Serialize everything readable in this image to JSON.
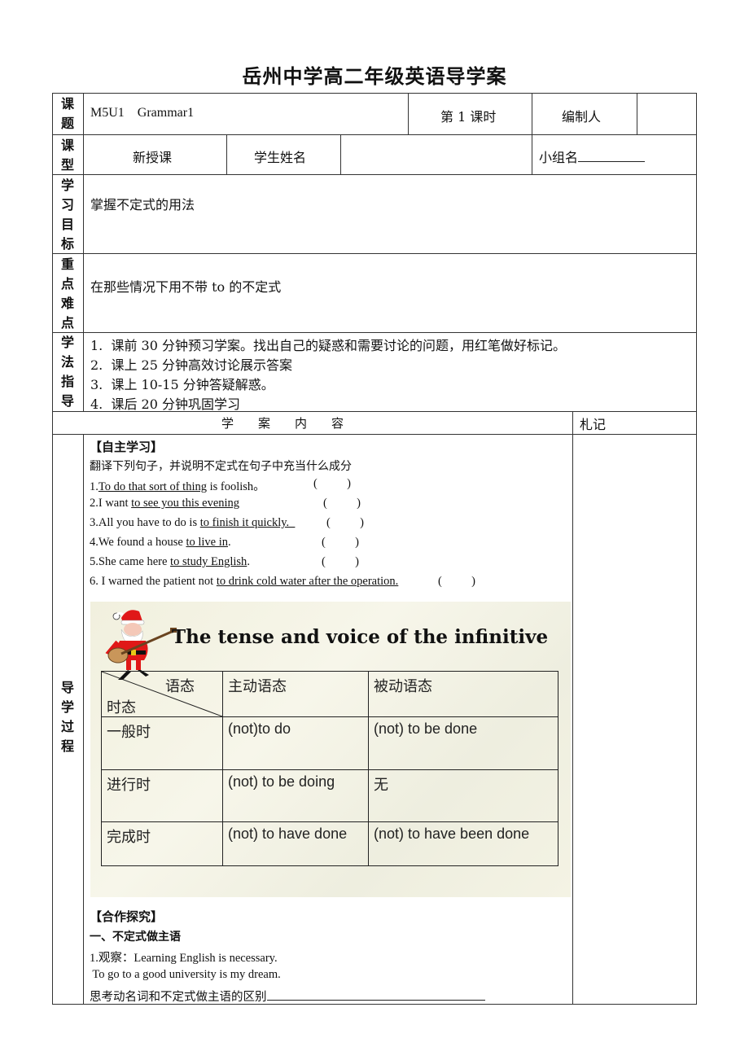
{
  "document": {
    "title": "岳州中学高二年级英语导学案"
  },
  "header_rows": {
    "row1": {
      "label": "课题",
      "topic": "M5U1    Grammar1",
      "period": "第 1 课时",
      "editor_label": "编制人",
      "editor_value": ""
    },
    "row2": {
      "label": "课型",
      "lesson_type": "新授课",
      "student_name_label": "学生姓名",
      "student_name_value": "",
      "group_label": "小组名"
    },
    "objectives": {
      "label": "学习目标",
      "text": "掌握不定式的用法"
    },
    "key_points": {
      "label": "重点难点",
      "text": "在那些情况下用不带 to 的不定式"
    },
    "method": {
      "label": "学法指导",
      "items": [
        "1.  课前 30 分钟预习学案。找出自己的疑惑和需要讨论的问题，用红笔做好标记。",
        "2.  课上 25 分钟高效讨论展示答案",
        "3.  课上 10-15 分钟答疑解惑。",
        "4.  课后 20 分钟巩固学习"
      ]
    }
  },
  "content_header": {
    "title": "学　　案　　内　　容",
    "notes": "札记"
  },
  "process": {
    "label": "导学过程",
    "self_study": {
      "heading": "【自主学习】",
      "instruction": "翻译下列句子，并说明不定式在句子中充当什么成分",
      "sentences": [
        {
          "prefix": "1.",
          "underlined": "To do that sort of thing",
          "suffix": " is foolish。",
          "paren": "(          )"
        },
        {
          "prefix": "2.I want ",
          "underlined": "to see you this evening",
          "suffix": "",
          "paren": "(          )"
        },
        {
          "prefix": "3.All you have to do is ",
          "underlined": "to finish it quickly.  ",
          "suffix": "",
          "paren": "(          )"
        },
        {
          "prefix": "4.We found a house ",
          "underlined": "to live in",
          "suffix": ".",
          "paren": "(          )"
        },
        {
          "prefix": "5.She came here ",
          "underlined": "to study English",
          "suffix": ".",
          "paren": "(          )"
        },
        {
          "prefix": "6. I warned the patient not ",
          "underlined": "to drink cold water after the operation.",
          "suffix": " ",
          "paren": "(          )"
        }
      ]
    },
    "slide": {
      "title": "The tense and voice of the infinitive",
      "image_icon": "santa-guitar-icon",
      "table": {
        "corner_top": "语态",
        "corner_bottom": "时态",
        "columns": [
          "主动语态",
          "被动语态"
        ],
        "rows": [
          {
            "tense": "一般时",
            "active": "(not)to do",
            "passive": "(not) to be done"
          },
          {
            "tense": "进行时",
            "active": "(not) to be doing",
            "passive": "无"
          },
          {
            "tense": "完成时",
            "active": "(not) to have done",
            "passive": "(not) to have been done"
          }
        ]
      }
    },
    "cooperation": {
      "heading": "【合作探究】",
      "subheading": "一、不定式做主语",
      "lines": [
        "1.观察：Learning English is necessary.",
        " To go to a good university is my dream.",
        "思考动名词和不定式做主语的区别"
      ]
    }
  }
}
